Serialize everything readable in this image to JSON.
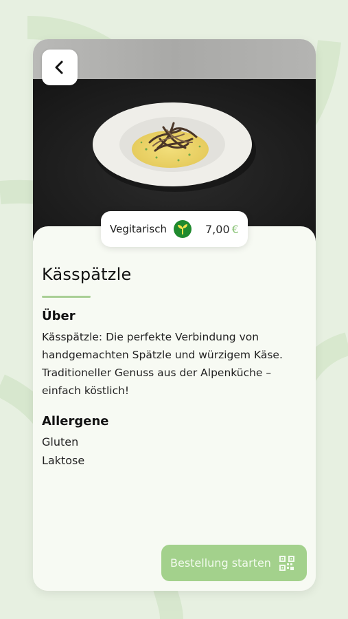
{
  "dish": {
    "name": "Kässpätzle",
    "diet_label": "Vegitarisch",
    "price": "7,00",
    "currency": "€"
  },
  "about": {
    "heading": "Über",
    "text": "Kässpätzle: Die perfekte Verbindung von handgemachten Spätzle und würzigem Käse. Traditioneller Genuss aus der Alpenküche – einfach köstlich!"
  },
  "allergens": {
    "heading": "Allergene",
    "items": [
      "Gluten",
      "Laktose"
    ]
  },
  "actions": {
    "order_label": "Bestellung starten"
  },
  "icons": {
    "back": "chevron-left-icon",
    "diet": "sprout-icon",
    "order": "qr-code-icon"
  },
  "colors": {
    "background": "#e7f0e1",
    "card": "#f7faf3",
    "accent": "#a3d18c",
    "diet_badge": "#1f8a2e"
  }
}
